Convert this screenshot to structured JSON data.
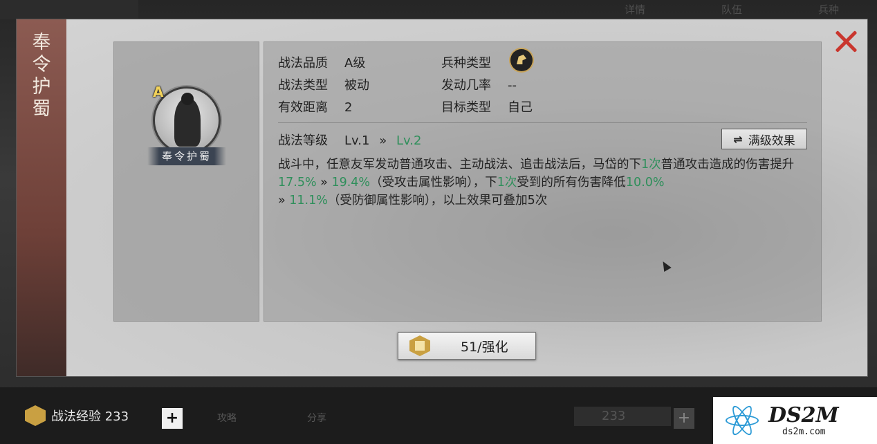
{
  "background": {
    "tabs": [
      "详情",
      "队伍",
      "兵种"
    ],
    "toolbar_items": [
      "攻略",
      "分享"
    ],
    "coin_value": "233"
  },
  "skill_panel": {
    "side_title": "奉令护蜀",
    "portrait": {
      "grade": "A",
      "name": "奉令护蜀"
    },
    "attributes": {
      "quality": {
        "label": "战法品质",
        "value": "A级"
      },
      "type": {
        "label": "战法类型",
        "value": "被动"
      },
      "range": {
        "label": "有效距离",
        "value": "2"
      },
      "unit_type": {
        "label": "兵种类型",
        "icon": "cavalry-horse-icon"
      },
      "trigger_rate": {
        "label": "发动几率",
        "value": "--"
      },
      "target_type": {
        "label": "目标类型",
        "value": "自己"
      }
    },
    "level": {
      "label": "战法等级",
      "current": "Lv.1",
      "arrow": "»",
      "next": "Lv.2"
    },
    "max_effect_button": "满级效果",
    "description": {
      "p1": "战斗中，任意友军发动普通攻击、主动战法、追击战法后，马岱的下",
      "n1": "1次",
      "p2": "普通攻击造成的伤害提升",
      "v1": "17.5%",
      "arrow1": " » ",
      "v2": "19.4%",
      "p3": "（受攻击属性影响），下",
      "n2": "1次",
      "p4": "受到的所有伤害降低",
      "v3": "10.0%",
      "arrow2": " » ",
      "v4": "11.1%",
      "p5": "（受防御属性影响），以上效果可叠加5次"
    },
    "upgrade_button": "51/强化"
  },
  "bottom_bar": {
    "exp_label": "战法经验 233",
    "plus": "+"
  },
  "watermark": {
    "big": "DS2M",
    "small": "ds2m.com"
  },
  "colors": {
    "highlight_green": "#2f8f5b",
    "close_red": "#c9362e",
    "side_tab": "#7a4a42"
  }
}
